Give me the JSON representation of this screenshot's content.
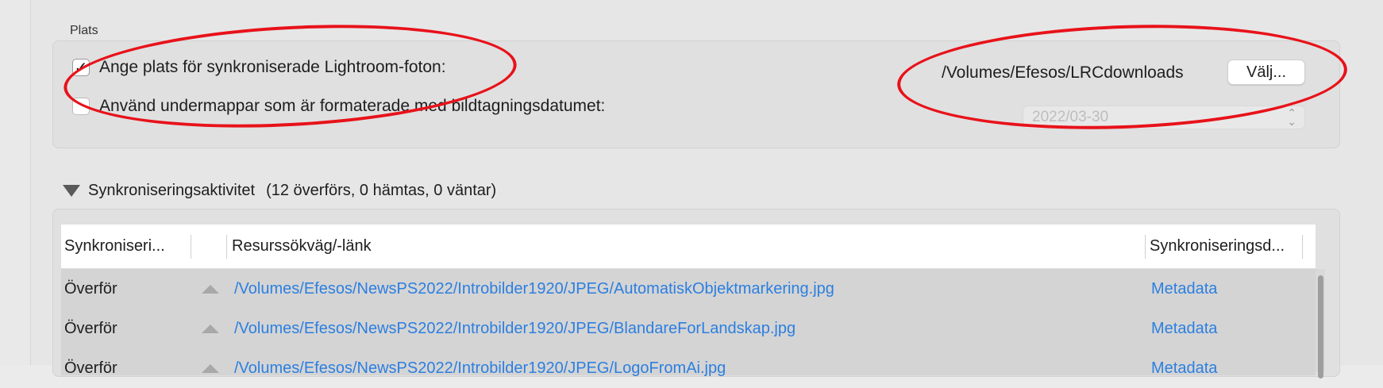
{
  "location": {
    "group_label": "Plats",
    "specify_location": {
      "label": "Ange plats för synkroniserade Lightroom-foton:",
      "checked": true
    },
    "path": "/Volumes/Efesos/LRCdownloads",
    "choose_button": "Välj...",
    "use_subfolders": {
      "label": "Använd undermappar som är formaterade med bildtagningsdatumet:",
      "checked": false
    },
    "date_format": "2022/03-30"
  },
  "activity": {
    "title": "Synkroniseringsaktivitet",
    "summary": "(12 överförs, 0 hämtas, 0 väntar)",
    "columns": [
      "Synkroniseri...",
      "Resurssökväg/-länk",
      "Synkroniseringsd..."
    ],
    "rows": [
      {
        "status": "Överför",
        "path": "/Volumes/Efesos/NewsPS2022/Introbilder1920/JPEG/AutomatiskObjektmarkering.jpg",
        "type": "Metadata"
      },
      {
        "status": "Överför",
        "path": "/Volumes/Efesos/NewsPS2022/Introbilder1920/JPEG/BlandareForLandskap.jpg",
        "type": "Metadata"
      },
      {
        "status": "Överför",
        "path": "/Volumes/Efesos/NewsPS2022/Introbilder1920/JPEG/LogoFromAi.jpg",
        "type": "Metadata"
      }
    ]
  },
  "colors": {
    "link": "#2c7fe0",
    "annotation": "#e8121a",
    "panel": "#e0e0e0"
  },
  "icons": {
    "checkbox_checked": "checkmark-icon",
    "disclosure": "disclosure-triangle-icon",
    "row_direction": "upload-arrow-icon",
    "stepper": "up-down-chevron-icon"
  }
}
